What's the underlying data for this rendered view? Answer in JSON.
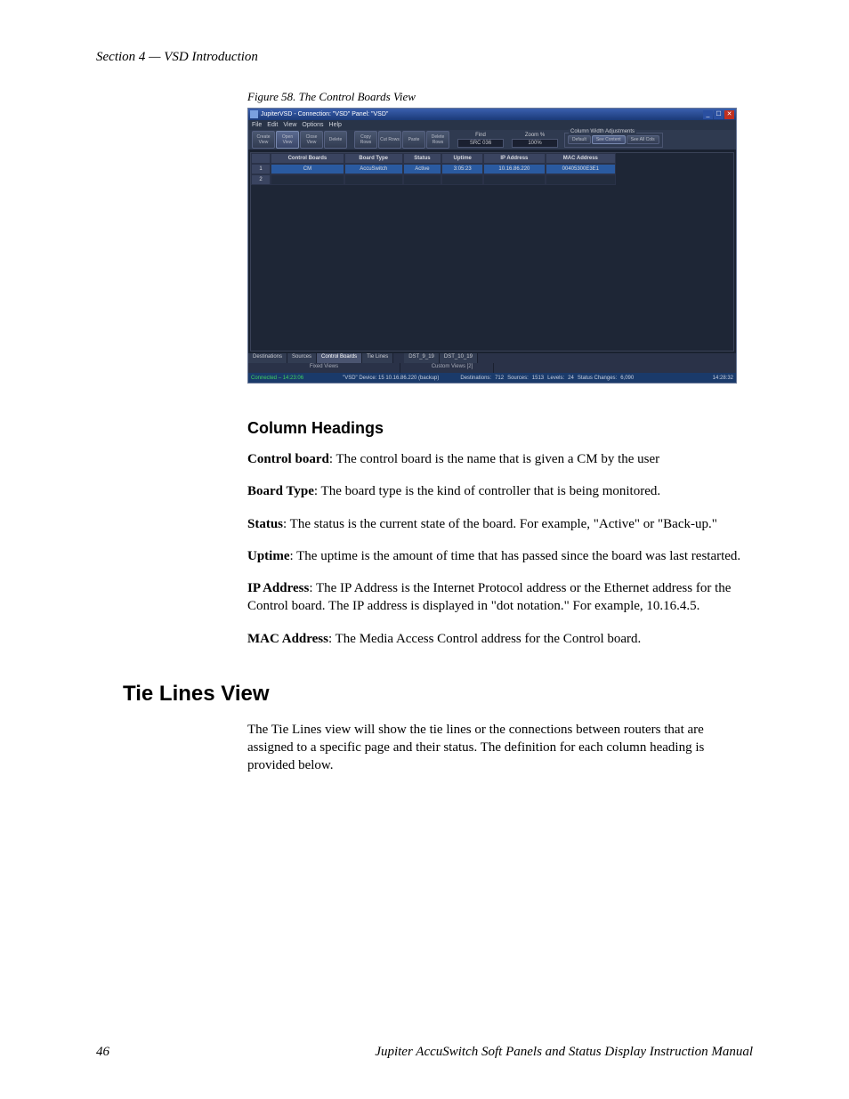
{
  "page": {
    "header": "Section 4 — VSD Introduction",
    "figure_caption": "Figure 58.  The Control Boards View",
    "page_number": "46",
    "footer_manual": "Jupiter AccuSwitch Soft Panels and Status Display Instruction Manual"
  },
  "headings": {
    "column_headings": "Column Headings",
    "tie_lines_view": "Tie Lines View"
  },
  "paragraphs": {
    "control_board_label": "Control board",
    "control_board_text": ": The control board is the name that is given a CM by the user",
    "board_type_label": "Board Type",
    "board_type_text": ": The board type is the kind of controller that is being monitored.",
    "status_label": "Status",
    "status_text": ": The status is the current state of the board. For example, \"Active\" or \"Back-up.\"",
    "uptime_label": "Uptime",
    "uptime_text": ": The uptime is the amount of time that has passed since the board was last restarted.",
    "ip_label": "IP Address",
    "ip_text": ": The IP Address is the Internet Protocol address or the Ethernet address for the Control board. The IP address is displayed in \"dot notation.\" For example, 10.16.4.5.",
    "mac_label": "MAC Address",
    "mac_text": ": The Media Access Control address for the Control board.",
    "tie_lines_text": "The Tie Lines view will show the tie lines or the connections between routers that are assigned to a specific page and their status. The definition for each column heading is provided below."
  },
  "app": {
    "title": "JupiterVSD - Connection: \"VSD\"  Panel: \"VSD\"",
    "menu": [
      "File",
      "Edit",
      "View",
      "Options",
      "Help"
    ],
    "toolbar": {
      "buttons": [
        "Create View",
        "Open View",
        "Close View",
        "Delete",
        "Copy Rows",
        "Cut Rows",
        "Paste",
        "Delete Rows"
      ],
      "find_label": "Find",
      "find_value": "SRC 036",
      "zoom_label": "Zoom %",
      "zoom_value": "100%",
      "col_adjust_label": "Column Width Adjustments",
      "col_buttons": [
        "Default",
        "See Content",
        "See All Cols"
      ]
    },
    "columns": [
      "",
      "Control Boards",
      "Board Type",
      "Status",
      "Uptime",
      "IP Address",
      "MAC Address"
    ],
    "rows": [
      {
        "idx": "1",
        "control_board": "CM",
        "board_type": "AccuSwitch",
        "status": "Active",
        "uptime": "3:05:23",
        "ip": "10.16.86.220",
        "mac": "00405300E3E1"
      },
      {
        "idx": "2",
        "control_board": "",
        "board_type": "",
        "status": "",
        "uptime": "",
        "ip": "",
        "mac": ""
      }
    ],
    "bottom_tabs_fixed_label": "Fixed Views",
    "bottom_tabs_fixed": [
      "Destinations",
      "Sources",
      "Control Boards",
      "Tie Lines"
    ],
    "bottom_tabs_custom_label": "Custom Views [2]",
    "bottom_tabs_custom": [
      "DST_9_19",
      "DST_10_19"
    ],
    "status": {
      "connected": "Connected – 14:23:06",
      "device": "\"VSD\" Device: 15  10.16.86.220 (backup)",
      "dest": "Destinations:",
      "dest_v": "712",
      "src": "Sources:",
      "src_v": "1513",
      "lvl": "Levels:",
      "lvl_v": "24",
      "sc": "Status Changes:",
      "sc_v": "6,090",
      "time": "14:28:32"
    }
  }
}
